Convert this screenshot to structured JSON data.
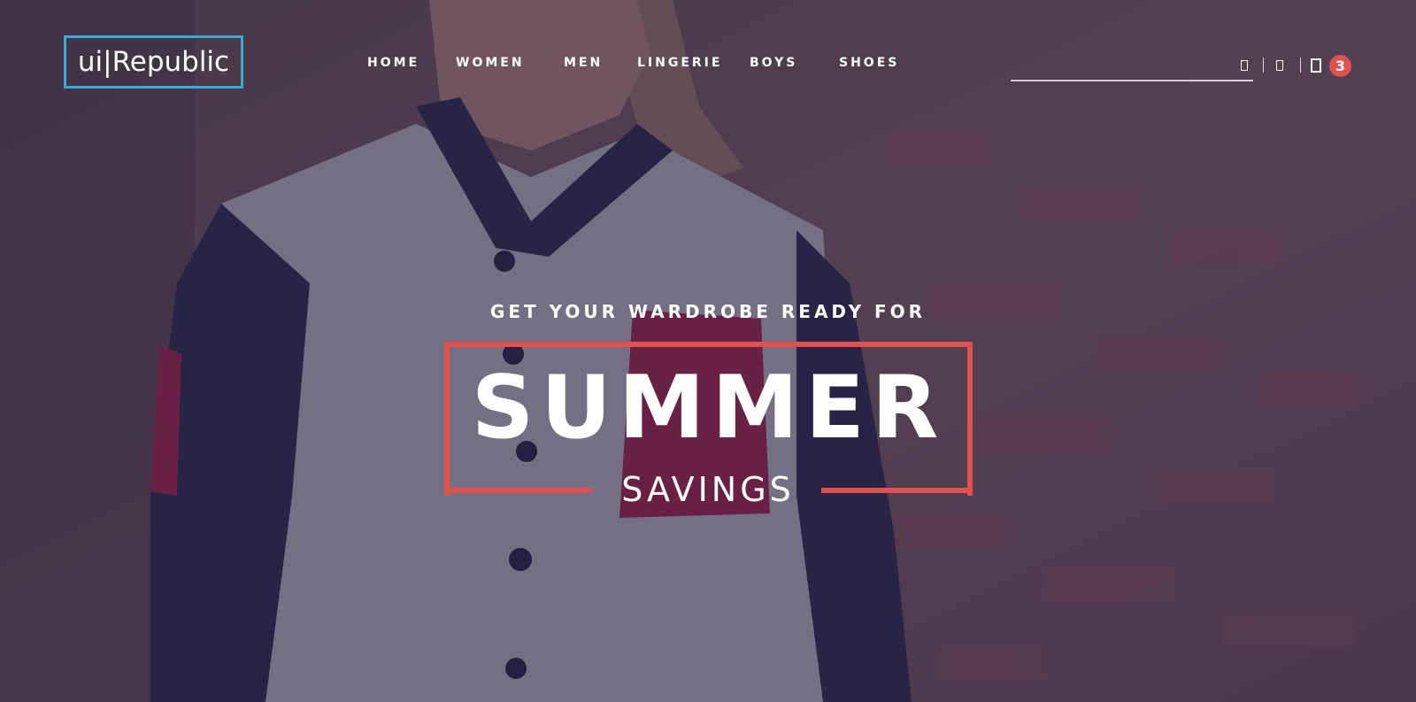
{
  "brand": {
    "logo_text": "ui|Republic",
    "accent_color": "#3aa9d8",
    "highlight_color": "#e0514f"
  },
  "nav": {
    "items": [
      {
        "label": "HOME"
      },
      {
        "label": "WOMEN"
      },
      {
        "label": "MEN"
      },
      {
        "label": "LINGERIE"
      },
      {
        "label": "BOYS"
      },
      {
        "label": "SHOES"
      }
    ]
  },
  "header": {
    "search_placeholder": "",
    "search_icon": "search-icon",
    "user_icon": "user-icon",
    "cart_icon": "cart-icon",
    "cart_count": "3"
  },
  "hero": {
    "kicker": "GET YOUR WARDROBE READY FOR",
    "headline": "SUMMER",
    "subline": "SAVINGS",
    "background_image": "woman in grey and navy varsity jacket leaning against a brick wall"
  }
}
